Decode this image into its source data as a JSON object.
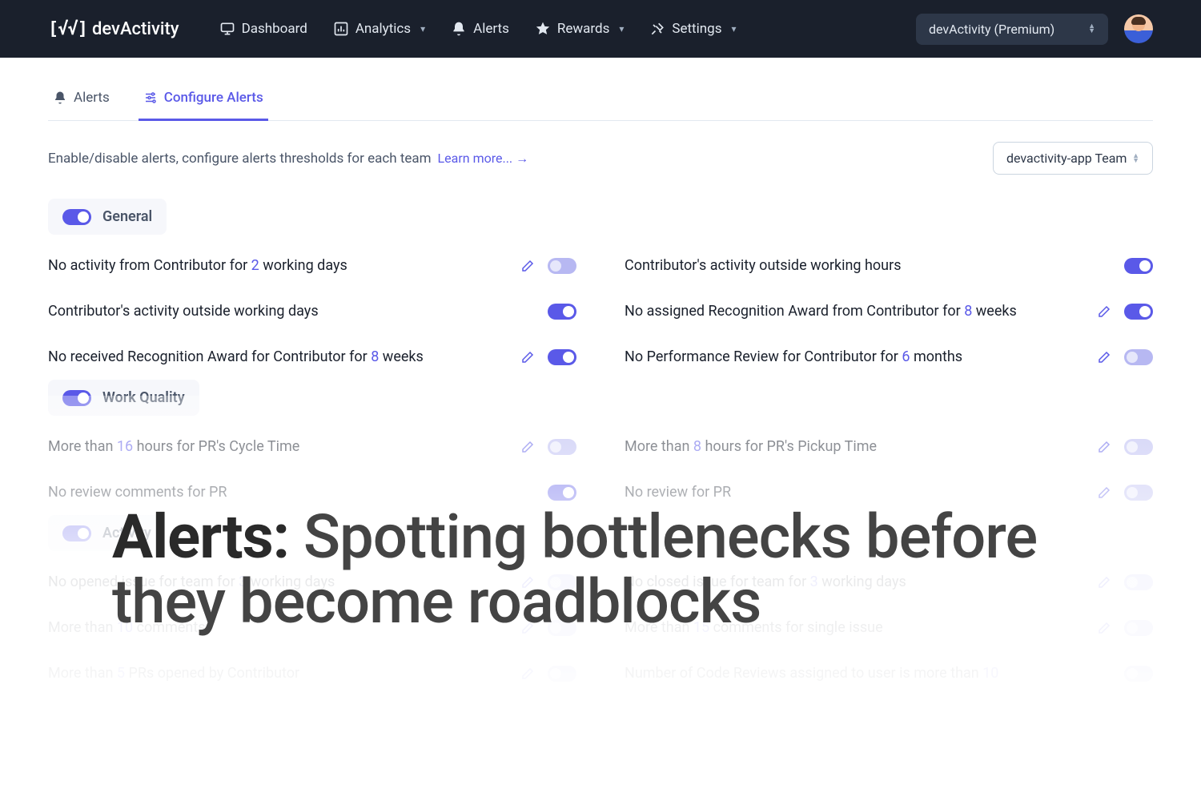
{
  "brand": "devActivity",
  "nav": {
    "dashboard": "Dashboard",
    "analytics": "Analytics",
    "alerts": "Alerts",
    "rewards": "Rewards",
    "settings": "Settings"
  },
  "account_select": "devActivity (Premium)",
  "tabs": {
    "alerts": "Alerts",
    "configure": "Configure Alerts"
  },
  "description": "Enable/disable alerts, configure alerts thresholds for each team",
  "learn_more": "Learn more... →",
  "team_select": "devactivity-app Team",
  "sections": {
    "general": {
      "title": "General",
      "rows": [
        {
          "pre": "No activity from Contributor for ",
          "val": "2",
          "post": " working days",
          "edit": true,
          "on": false
        },
        {
          "pre": "Contributor's activity outside working hours",
          "val": "",
          "post": "",
          "edit": false,
          "on": true
        },
        {
          "pre": "Contributor's activity outside working days",
          "val": "",
          "post": "",
          "edit": false,
          "on": true
        },
        {
          "pre": "No assigned Recognition Award from Contributor for ",
          "val": "8",
          "post": " weeks",
          "edit": true,
          "on": true
        },
        {
          "pre": "No received Recognition Award for Contributor for ",
          "val": "8",
          "post": " weeks",
          "edit": true,
          "on": true
        },
        {
          "pre": "No Performance Review for Contributor for ",
          "val": "6",
          "post": " months",
          "edit": true,
          "on": false
        }
      ]
    },
    "work_quality": {
      "title": "Work Quality",
      "rows": [
        {
          "pre": "More than ",
          "val": "16",
          "post": " hours for PR's Cycle Time",
          "edit": true,
          "on": false
        },
        {
          "pre": "More than ",
          "val": "8",
          "post": " hours for PR's Pickup Time",
          "edit": true,
          "on": false
        },
        {
          "pre": "No review comments for PR",
          "val": "",
          "post": "",
          "edit": false,
          "on": true
        },
        {
          "pre": "No review for PR",
          "val": "",
          "post": "",
          "edit": true,
          "on": false
        }
      ]
    },
    "activity": {
      "title": "Activity",
      "rows": [
        {
          "pre": "No opened issue for team for ",
          "val": "3",
          "post": " working days",
          "edit": true,
          "on": false
        },
        {
          "pre": "No closed issue for team for ",
          "val": "3",
          "post": " working days",
          "edit": true,
          "on": false
        },
        {
          "pre": "More than ",
          "val": "10",
          "post": " comments",
          "edit": true,
          "on": false
        },
        {
          "pre": "More than ",
          "val": "15",
          "post": " comments for single issue",
          "edit": true,
          "on": false
        },
        {
          "pre": "More than ",
          "val": "5",
          "post": " PRs opened by Contributor",
          "edit": true,
          "on": false
        },
        {
          "pre": "Number of Code Reviews assigned to user is more than ",
          "val": "10",
          "post": "",
          "edit": false,
          "on": false
        }
      ]
    }
  },
  "hero_strong": "Alerts: ",
  "hero_rest": "Spotting bottlenecks before they become roadblocks"
}
